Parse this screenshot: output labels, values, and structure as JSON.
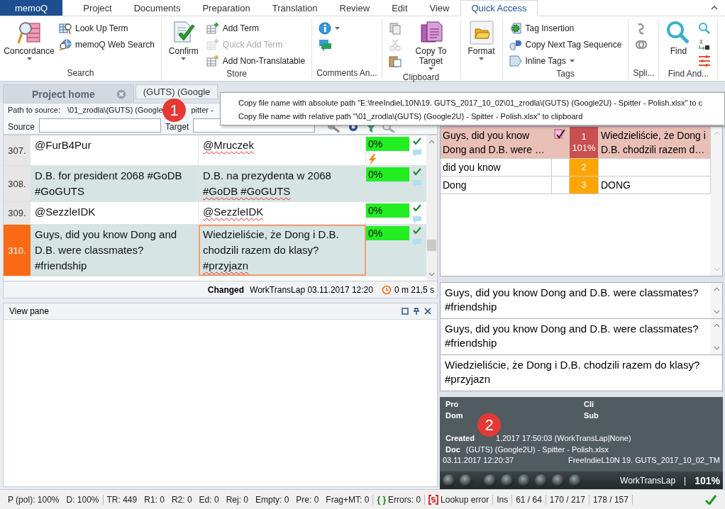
{
  "ribbon": {
    "tabs": [
      {
        "label": "memoQ",
        "kind": "app",
        "selected": false
      },
      {
        "label": "Project",
        "kind": "tab",
        "selected": false
      },
      {
        "label": "Documents",
        "kind": "tab",
        "selected": false
      },
      {
        "label": "Preparation",
        "kind": "tab",
        "selected": false
      },
      {
        "label": "Translation",
        "kind": "tab",
        "selected": false
      },
      {
        "label": "Review",
        "kind": "tab",
        "selected": false
      },
      {
        "label": "Edit",
        "kind": "tab",
        "selected": false
      },
      {
        "label": "View",
        "kind": "tab",
        "selected": false
      },
      {
        "label": "Quick Access",
        "kind": "tab",
        "selected": true
      }
    ],
    "groups": [
      {
        "label": "Search",
        "items": [
          {
            "kind": "large",
            "label": "Concordance",
            "dropdown": true,
            "disabled": false
          },
          {
            "kind": "small",
            "label": "Look Up Term",
            "dropdown": false,
            "disabled": false
          },
          {
            "kind": "small",
            "label": "memoQ Web Search",
            "dropdown": false,
            "disabled": false
          }
        ]
      },
      {
        "label": "Store",
        "items": [
          {
            "kind": "large",
            "label": "Confirm",
            "dropdown": true,
            "disabled": false
          },
          {
            "kind": "small",
            "label": "Add Term",
            "dropdown": false,
            "disabled": false
          },
          {
            "kind": "small",
            "label": "Quick Add Term",
            "dropdown": false,
            "disabled": true
          },
          {
            "kind": "small",
            "label": "Add Non-Translatable",
            "dropdown": false,
            "disabled": false
          }
        ]
      },
      {
        "label": "Comments An...",
        "items": [
          {
            "kind": "small",
            "dropdown": true,
            "disabled": false
          },
          {
            "kind": "small",
            "dropdown": false,
            "disabled": false
          }
        ]
      },
      {
        "label": "Clipboard",
        "items": [
          {
            "kind": "small",
            "dropdown": false,
            "disabled": false
          },
          {
            "kind": "small",
            "dropdown": false,
            "disabled": true
          },
          {
            "kind": "small",
            "dropdown": false,
            "disabled": false
          },
          {
            "kind": "large",
            "label": "Copy To Target",
            "dropdown": true,
            "disabled": false
          }
        ]
      },
      {
        "items": [
          {
            "kind": "large",
            "label": "Format",
            "dropdown": true,
            "disabled": false
          }
        ]
      },
      {
        "label": "Tags",
        "items": [
          {
            "kind": "small",
            "label": "Tag Insertion",
            "dropdown": false,
            "disabled": false
          },
          {
            "kind": "small",
            "label": "Copy Next Tag Sequence",
            "dropdown": false,
            "disabled": false
          },
          {
            "kind": "small",
            "label": "Inline Tags",
            "dropdown": true,
            "disabled": false
          }
        ]
      },
      {
        "label": "Spli...",
        "items": [
          {
            "kind": "small",
            "dropdown": false,
            "disabled": false
          },
          {
            "kind": "small",
            "dropdown": false,
            "disabled": false
          }
        ]
      },
      {
        "label": "Find And...",
        "items": [
          {
            "kind": "large",
            "label": "Find",
            "dropdown": false,
            "disabled": false
          },
          {
            "kind": "small",
            "dropdown": false,
            "disabled": false
          },
          {
            "kind": "small",
            "dropdown": false,
            "disabled": false
          },
          {
            "kind": "small",
            "dropdown": false,
            "disabled": false
          }
        ]
      }
    ]
  },
  "document_tabs": [
    {
      "label": "Project home",
      "selected": true,
      "closable": true
    },
    {
      "label": "(GUTS) (Google",
      "selected": false,
      "closable": false
    }
  ],
  "editor": {
    "path": {
      "label": "Path to source:",
      "value": "\\01_zrodla\\(GUTS) (Google",
      "value_after_marker": "pitter -"
    },
    "filters": [
      {
        "label": "Source"
      },
      {
        "label": "Target"
      }
    ],
    "rows": [
      {
        "number": "307.",
        "source": "@FurB4Pur",
        "target": [
          {
            "text": "@Mruczek",
            "misspelled": true
          }
        ],
        "match": "0%",
        "confirmed": true,
        "comment": true,
        "warning": true,
        "highlighted": false,
        "selected": false
      },
      {
        "number": "308.",
        "source": "D.B. for president 2068 #GoDB #GoGUTS",
        "target": [
          {
            "text": "D.B. na prezydenta w 2068 ",
            "misspelled": false
          },
          {
            "text": "#GoDB #GoGUTS",
            "misspelled": true
          }
        ],
        "match": "0%",
        "confirmed": true,
        "comment": true,
        "warning": false,
        "highlighted": true,
        "selected": false
      },
      {
        "number": "309.",
        "source": "@SezzleIDK",
        "target": [
          {
            "text": "@SezzleIDK",
            "misspelled": true
          }
        ],
        "match": "0%",
        "confirmed": true,
        "comment": true,
        "warning": false,
        "highlighted": false,
        "selected": false
      },
      {
        "number": "310.",
        "source": "Guys, did you know Dong and D.B. were classmates? #friendship",
        "target": [
          {
            "text": "Wiedzieliście, że Dong i D.B. chodzili razem do klasy? ",
            "misspelled": false
          },
          {
            "text": "#przyjazn",
            "misspelled": true
          }
        ],
        "match": "0%",
        "confirmed": true,
        "comment": true,
        "warning": false,
        "highlighted": true,
        "selected": true
      }
    ],
    "status": {
      "state": "Changed",
      "detail": "WorkTransLap 03.11.2017 12:20",
      "time": "0 m 21,5 s"
    }
  },
  "view_pane": {
    "title": "View pane"
  },
  "results": [
    {
      "kind": "tm",
      "source": "Guys, did you know Dong and D.B. were …",
      "number": "1",
      "score": "101%",
      "color": "#c9504f",
      "target": "Wiedzieliście, że Dong i D.B. chodzili razem d…",
      "selected": true
    },
    {
      "kind": "term",
      "source": "did you know",
      "number": "2",
      "color": "#ffa500",
      "selected": false
    },
    {
      "kind": "term",
      "source": "Dong",
      "number": "3",
      "color": "#ffa500",
      "target": "DONG",
      "selected": false
    }
  ],
  "compare": [
    {
      "text": "Guys, did you know Dong and D.B. were classmates? #friendship",
      "scrollable": true
    },
    {
      "text": "Guys, did you know Dong and D.B. were classmates? #friendship",
      "scrollable": true
    },
    {
      "text": "Wiedzieliście, że Dong i D.B. chodzili razem do klasy? #przyjazn",
      "scrollable": false
    }
  ],
  "info": {
    "fields": [
      {
        "label": "Pro"
      },
      {
        "label": "Cli"
      },
      {
        "label": "Dom"
      },
      {
        "label": "Sub"
      }
    ],
    "created": {
      "label": "Created",
      "value": "1.2017 17:50:03 (WorkTransLap|None)"
    },
    "doc": {
      "label": "Doc",
      "value": "(GUTS) (Google2U) - Spitter - Polish.xlsx"
    },
    "timestamp": "03.11.2017 12:20:37",
    "tm": "FreeIndieL10N 19. GUTS_2017_10_02_TM",
    "user": "WorkTransLap",
    "separator": "|",
    "score": "101%"
  },
  "status_bar": {
    "sections": [
      {
        "items": [
          {
            "kind": "text",
            "text": "P (pol): 100%"
          },
          {
            "kind": "text",
            "text": "D: 100%"
          }
        ]
      },
      {
        "items": [
          {
            "kind": "text",
            "text": "TR: 449"
          },
          {
            "kind": "text",
            "text": "R1: 0"
          },
          {
            "kind": "text",
            "text": "R2: 0"
          },
          {
            "kind": "text",
            "text": "Ed: 0"
          },
          {
            "kind": "text",
            "text": "Rej: 0"
          },
          {
            "kind": "text",
            "text": "Empty: 0"
          },
          {
            "kind": "text",
            "text": "Pre: 0"
          },
          {
            "kind": "text",
            "text": "Frag+MT: 0"
          }
        ]
      },
      {
        "items": [
          {
            "kind": "errors",
            "glyph": "{ }",
            "text": "Errors: 0"
          }
        ]
      },
      {
        "items": [
          {
            "kind": "lookup",
            "text": "Lookup error"
          }
        ]
      },
      {
        "items": [
          {
            "kind": "text",
            "text": "Ins"
          }
        ]
      },
      {
        "items": [
          {
            "kind": "text",
            "text": "61 / 64"
          }
        ]
      },
      {
        "items": [
          {
            "kind": "text",
            "text": "170 / 217"
          }
        ]
      },
      {
        "items": [
          {
            "kind": "text",
            "text": "178 / 157"
          }
        ]
      },
      {
        "items": [
          {
            "kind": "ok"
          }
        ]
      }
    ]
  },
  "context_menu": [
    "Copy file name with absolute path \"E:\\freeIndieL10N\\19. GUTS_2017_10_02\\01_zrodla\\(GUTS) (Google2U) - Spitter - Polish.xlsx\" to c",
    "Copy file name with relative path \"\\01_zrodla\\(GUTS) (Google2U) - Spitter - Polish.xlsx\" to clipboard"
  ],
  "markers": [
    {
      "number": "1"
    },
    {
      "number": "2"
    }
  ]
}
